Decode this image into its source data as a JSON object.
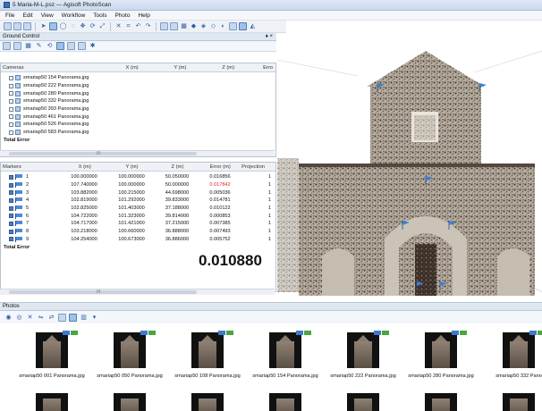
{
  "window": {
    "title": "5 Maria-M-L.psz — Agisoft PhotoScan"
  },
  "menu": [
    "File",
    "Edit",
    "View",
    "Workflow",
    "Tools",
    "Photo",
    "Help"
  ],
  "ground_control": {
    "title": "Ground Control",
    "title_controls": "♦ ×",
    "cameras": {
      "headers": [
        "Cameras",
        "X (m)",
        "Y (m)",
        "Z (m)",
        "Erro"
      ],
      "rows": [
        "smariap50 154 Panorama.jpg",
        "smariap50 222 Panorama.jpg",
        "smariap50 280 Panorama.jpg",
        "smariap50 332 Panorama.jpg",
        "smariap50 393 Panorama.jpg",
        "smariap50 461 Panorama.jpg",
        "smariap50 526 Panorama.jpg",
        "smariap50 583 Panorama.jpg"
      ],
      "total_label": "Total Error"
    },
    "markers": {
      "headers": [
        "Markers",
        "X (m)",
        "Y (m)",
        "Z (m)",
        "Error (m)",
        "Projection"
      ],
      "rows": [
        {
          "name": "1",
          "x": "100.000000",
          "y": "100.000000",
          "z": "50.050000",
          "err": "0.016856",
          "proj": "1"
        },
        {
          "name": "2",
          "x": "107.740000",
          "y": "100.000000",
          "z": "50.000000",
          "err": "0.017842",
          "proj": "1"
        },
        {
          "name": "3",
          "x": "103.882000",
          "y": "100.215000",
          "z": "44.698000",
          "err": "0.005036",
          "proj": "1"
        },
        {
          "name": "4",
          "x": "102.819000",
          "y": "101.292000",
          "z": "39.833000",
          "err": "0.014781",
          "proj": "1"
        },
        {
          "name": "5",
          "x": "102.825000",
          "y": "101.403000",
          "z": "37.188000",
          "err": "0.010122",
          "proj": "1"
        },
        {
          "name": "6",
          "x": "104.722000",
          "y": "101.323000",
          "z": "39.814000",
          "err": "0.000853",
          "proj": "1"
        },
        {
          "name": "7",
          "x": "104.717000",
          "y": "101.421000",
          "z": "37.215000",
          "err": "0.007385",
          "proj": "1"
        },
        {
          "name": "8",
          "x": "103.218000",
          "y": "100.660000",
          "z": "36.888000",
          "err": "0.007493",
          "proj": "1"
        },
        {
          "name": "9",
          "x": "104.254000",
          "y": "100.673000",
          "z": "36.886000",
          "err": "0.005752",
          "proj": "1"
        }
      ],
      "total_label": "Total Error",
      "total_value": "0.010880"
    },
    "scroll_grip": "III"
  },
  "photos": {
    "title": "Photos",
    "items": [
      "smariap50 001 Panorama.jpg",
      "smariap50 050 Panorama.jpg",
      "smariap50 108 Panorama.jpg",
      "smariap50 154 Panorama.jpg",
      "smariap50 222 Panorama.jpg",
      "smariap50 280 Panorama.jpg",
      "smariap50 332 Pano"
    ]
  },
  "colors": {
    "accent": "#4b7fc4",
    "error_highlight": "#d42b2b",
    "panel_header": "#dfe7f1"
  }
}
